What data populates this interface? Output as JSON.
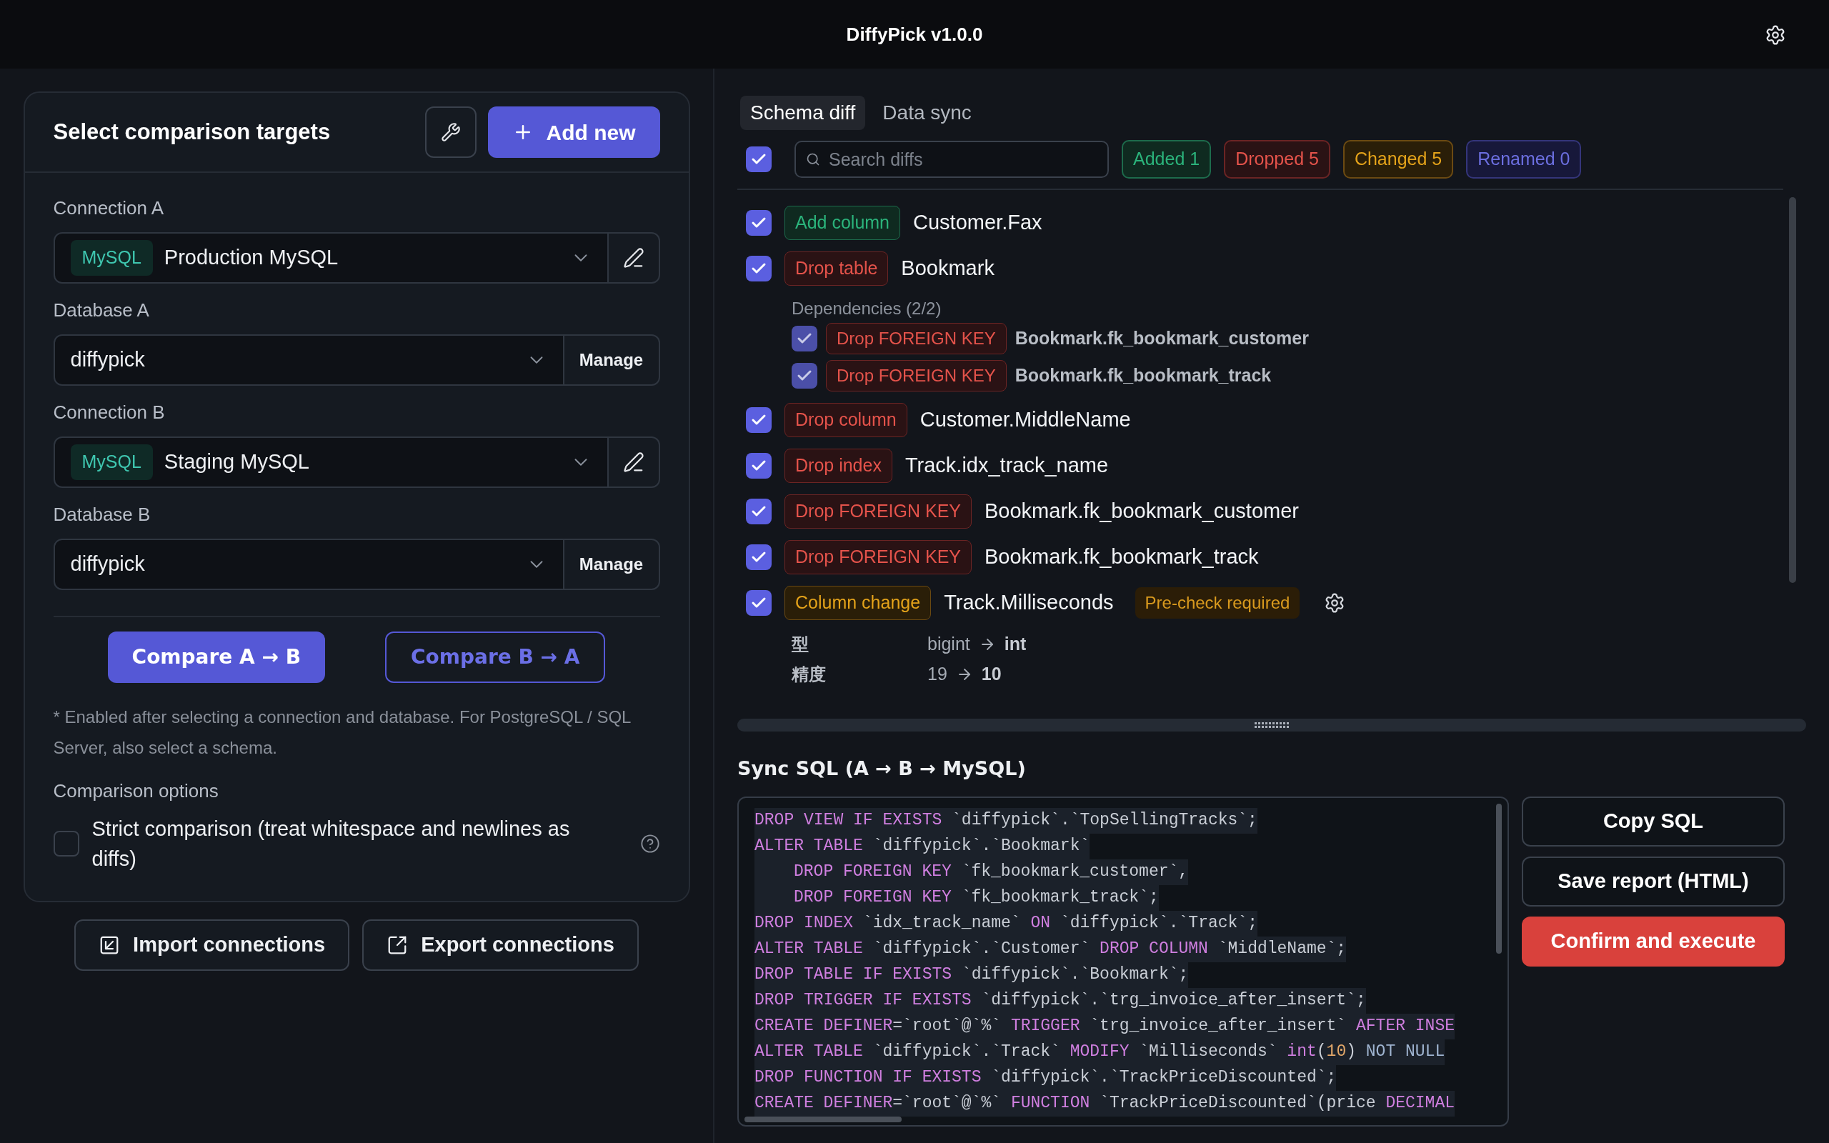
{
  "app": {
    "title": "DiffyPick v1.0.0"
  },
  "targets": {
    "title": "Select comparison targets",
    "add_button": "Add new",
    "fields": [
      {
        "kind": "connection",
        "label": "Connection A",
        "engine": "MySQL",
        "value": "Production MySQL"
      },
      {
        "kind": "database",
        "label": "Database A",
        "value": "diffypick",
        "action": "Manage"
      },
      {
        "kind": "connection",
        "label": "Connection B",
        "engine": "MySQL",
        "value": "Staging MySQL"
      },
      {
        "kind": "database",
        "label": "Database B",
        "value": "diffypick",
        "action": "Manage"
      }
    ],
    "compare_buttons": [
      {
        "kind": "primary",
        "label": "Compare A → B"
      },
      {
        "kind": "outline",
        "label": "Compare B → A"
      }
    ],
    "note": "* Enabled after selecting a connection and database. For PostgreSQL / SQL Server, also select a schema.",
    "options_label": "Comparison options",
    "options": [
      {
        "label": "Strict comparison (treat whitespace and newlines as diffs)",
        "checked": false
      }
    ]
  },
  "footer_buttons": [
    {
      "kind": "import",
      "label": "Import connections"
    },
    {
      "kind": "export",
      "label": "Export connections"
    }
  ],
  "tabs": [
    {
      "label": "Schema diff",
      "selected": true
    },
    {
      "label": "Data sync",
      "selected": false
    }
  ],
  "filter": {
    "all_checked": true,
    "search": {
      "placeholder": "Search diffs"
    },
    "counts": [
      {
        "kind": "added",
        "label": "Added 1"
      },
      {
        "kind": "dropped",
        "label": "Dropped 5"
      },
      {
        "kind": "changed",
        "label": "Changed 5"
      },
      {
        "kind": "renamed",
        "label": "Renamed 0"
      }
    ]
  },
  "diffs": [
    {
      "checked": true,
      "kind": "added",
      "action": "Add column",
      "target": "Customer.Fax"
    },
    {
      "checked": true,
      "kind": "dropped",
      "action": "Drop table",
      "target": "Bookmark",
      "dependencies": {
        "label": "Dependencies (2/2)",
        "items": [
          {
            "checked": true,
            "kind": "dropped",
            "action": "Drop FOREIGN KEY",
            "target": "Bookmark.fk_bookmark_customer"
          },
          {
            "checked": true,
            "kind": "dropped",
            "action": "Drop FOREIGN KEY",
            "target": "Bookmark.fk_bookmark_track"
          }
        ]
      }
    },
    {
      "checked": true,
      "kind": "dropped",
      "action": "Drop column",
      "target": "Customer.MiddleName"
    },
    {
      "checked": true,
      "kind": "dropped",
      "action": "Drop index",
      "target": "Track.idx_track_name"
    },
    {
      "checked": true,
      "kind": "dropped",
      "action": "Drop FOREIGN KEY",
      "target": "Bookmark.fk_bookmark_customer"
    },
    {
      "checked": true,
      "kind": "dropped",
      "action": "Drop FOREIGN KEY",
      "target": "Bookmark.fk_bookmark_track"
    },
    {
      "checked": true,
      "kind": "changed",
      "action": "Column change",
      "target": "Track.Milliseconds",
      "precheck": "Pre-check required",
      "changes": [
        {
          "field": "型",
          "from": "bigint",
          "to": "int"
        },
        {
          "field": "精度",
          "from": "19",
          "to": "10"
        }
      ]
    }
  ],
  "sql": {
    "title": "Sync SQL (A → B → MySQL)",
    "lines": [
      [
        {
          "kind": "keyword",
          "text": "DROP VIEW IF EXISTS"
        },
        {
          "kind": "plain",
          "text": " `diffypick`.`TopSellingTracks`;"
        }
      ],
      [
        {
          "kind": "keyword",
          "text": "ALTER TABLE"
        },
        {
          "kind": "plain",
          "text": " `diffypick`.`Bookmark`"
        }
      ],
      [
        {
          "kind": "indent"
        },
        {
          "kind": "keyword",
          "text": "DROP FOREIGN KEY"
        },
        {
          "kind": "plain",
          "text": " `fk_bookmark_customer`,"
        }
      ],
      [
        {
          "kind": "indent"
        },
        {
          "kind": "keyword",
          "text": "DROP FOREIGN KEY"
        },
        {
          "kind": "plain",
          "text": " `fk_bookmark_track`;"
        }
      ],
      [
        {
          "kind": "keyword",
          "text": "DROP INDEX"
        },
        {
          "kind": "plain",
          "text": " `idx_track_name` "
        },
        {
          "kind": "keyword",
          "text": "ON"
        },
        {
          "kind": "plain",
          "text": " `diffypick`.`Track`;"
        }
      ],
      [
        {
          "kind": "keyword",
          "text": "ALTER TABLE"
        },
        {
          "kind": "plain",
          "text": " `diffypick`.`Customer` "
        },
        {
          "kind": "keyword",
          "text": "DROP COLUMN"
        },
        {
          "kind": "plain",
          "text": " `MiddleName`;"
        }
      ],
      [
        {
          "kind": "keyword",
          "text": "DROP TABLE IF EXISTS"
        },
        {
          "kind": "plain",
          "text": " `diffypick`.`Bookmark`;"
        }
      ],
      [
        {
          "kind": "keyword",
          "text": "DROP TRIGGER IF EXISTS"
        },
        {
          "kind": "plain",
          "text": " `diffypick`.`trg_invoice_after_insert`;"
        }
      ],
      [
        {
          "kind": "keyword",
          "text": "CREATE DEFINER"
        },
        {
          "kind": "plain",
          "text": "=`root`@`%` "
        },
        {
          "kind": "keyword",
          "text": "TRIGGER"
        },
        {
          "kind": "plain",
          "text": " `trg_invoice_after_insert` "
        },
        {
          "kind": "keyword",
          "text": "AFTER INSE"
        }
      ],
      [
        {
          "kind": "keyword",
          "text": "ALTER TABLE"
        },
        {
          "kind": "plain",
          "text": " `diffypick`.`Track` "
        },
        {
          "kind": "keyword",
          "text": "MODIFY"
        },
        {
          "kind": "plain",
          "text": " `Milliseconds` "
        },
        {
          "kind": "keyword",
          "text": "int"
        },
        {
          "kind": "plain",
          "text": "("
        },
        {
          "kind": "number",
          "text": "10"
        },
        {
          "kind": "plain",
          "text": ") "
        },
        {
          "kind": "constant",
          "text": "NOT NULL"
        }
      ],
      [
        {
          "kind": "keyword",
          "text": "DROP FUNCTION IF EXISTS"
        },
        {
          "kind": "plain",
          "text": " `diffypick`.`TrackPriceDiscounted`;"
        }
      ],
      [
        {
          "kind": "keyword",
          "text": "CREATE DEFINER"
        },
        {
          "kind": "plain",
          "text": "=`root`@`%` "
        },
        {
          "kind": "keyword",
          "text": "FUNCTION"
        },
        {
          "kind": "plain",
          "text": " `TrackPriceDiscounted`(price "
        },
        {
          "kind": "keyword",
          "text": "DECIMAL"
        }
      ]
    ]
  },
  "actions": [
    {
      "kind": "secondary",
      "label": "Copy SQL"
    },
    {
      "kind": "secondary",
      "label": "Save report (HTML)"
    },
    {
      "kind": "danger",
      "label": "Confirm and execute"
    }
  ]
}
